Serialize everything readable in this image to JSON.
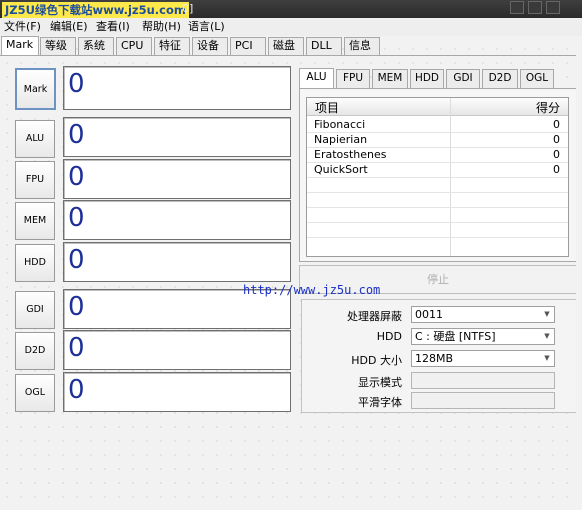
{
  "titlebar": {
    "watermark": "JZ5U绿色下载站www.jz5u.com",
    "tail": "0]"
  },
  "menu": [
    "文件(F)",
    "编辑(E)",
    "查看(I)",
    "帮助(H)",
    "语言(L)"
  ],
  "tabs": [
    "Mark",
    "等级",
    "系统",
    "CPU",
    "特征",
    "设备",
    "PCI",
    "磁盘",
    "DLL",
    "信息"
  ],
  "benchmarks": [
    {
      "label": "Mark",
      "score": "0"
    },
    {
      "label": "ALU",
      "score": "0"
    },
    {
      "label": "FPU",
      "score": "0"
    },
    {
      "label": "MEM",
      "score": "0"
    },
    {
      "label": "HDD",
      "score": "0"
    },
    {
      "label": "GDI",
      "score": "0"
    },
    {
      "label": "D2D",
      "score": "0"
    },
    {
      "label": "OGL",
      "score": "0"
    }
  ],
  "subtabs": [
    "ALU",
    "FPU",
    "MEM",
    "HDD",
    "GDI",
    "D2D",
    "OGL"
  ],
  "list": {
    "col_item": "项目",
    "col_score": "得分",
    "rows": [
      {
        "name": "Fibonacci",
        "score": "0"
      },
      {
        "name": "Napierian",
        "score": "0"
      },
      {
        "name": "Eratosthenes",
        "score": "0"
      },
      {
        "name": "QuickSort",
        "score": "0"
      }
    ]
  },
  "stop_label": "停止",
  "url_watermark": "http://www.jz5u.com",
  "settings": {
    "cpu_mask_label": "处理器屏蔽",
    "cpu_mask_value": "0011",
    "hdd_label": "HDD",
    "hdd_value": "C : 硬盘 [NTFS]",
    "hdd_size_label": "HDD 大小",
    "hdd_size_value": "128MB",
    "display_mode_label": "显示模式",
    "smooth_font_label": "平滑字体"
  },
  "colors": {
    "score_text": "#1e2f9a",
    "url_text": "#1a2fc4",
    "watermark_bg": "#ffe94a"
  }
}
